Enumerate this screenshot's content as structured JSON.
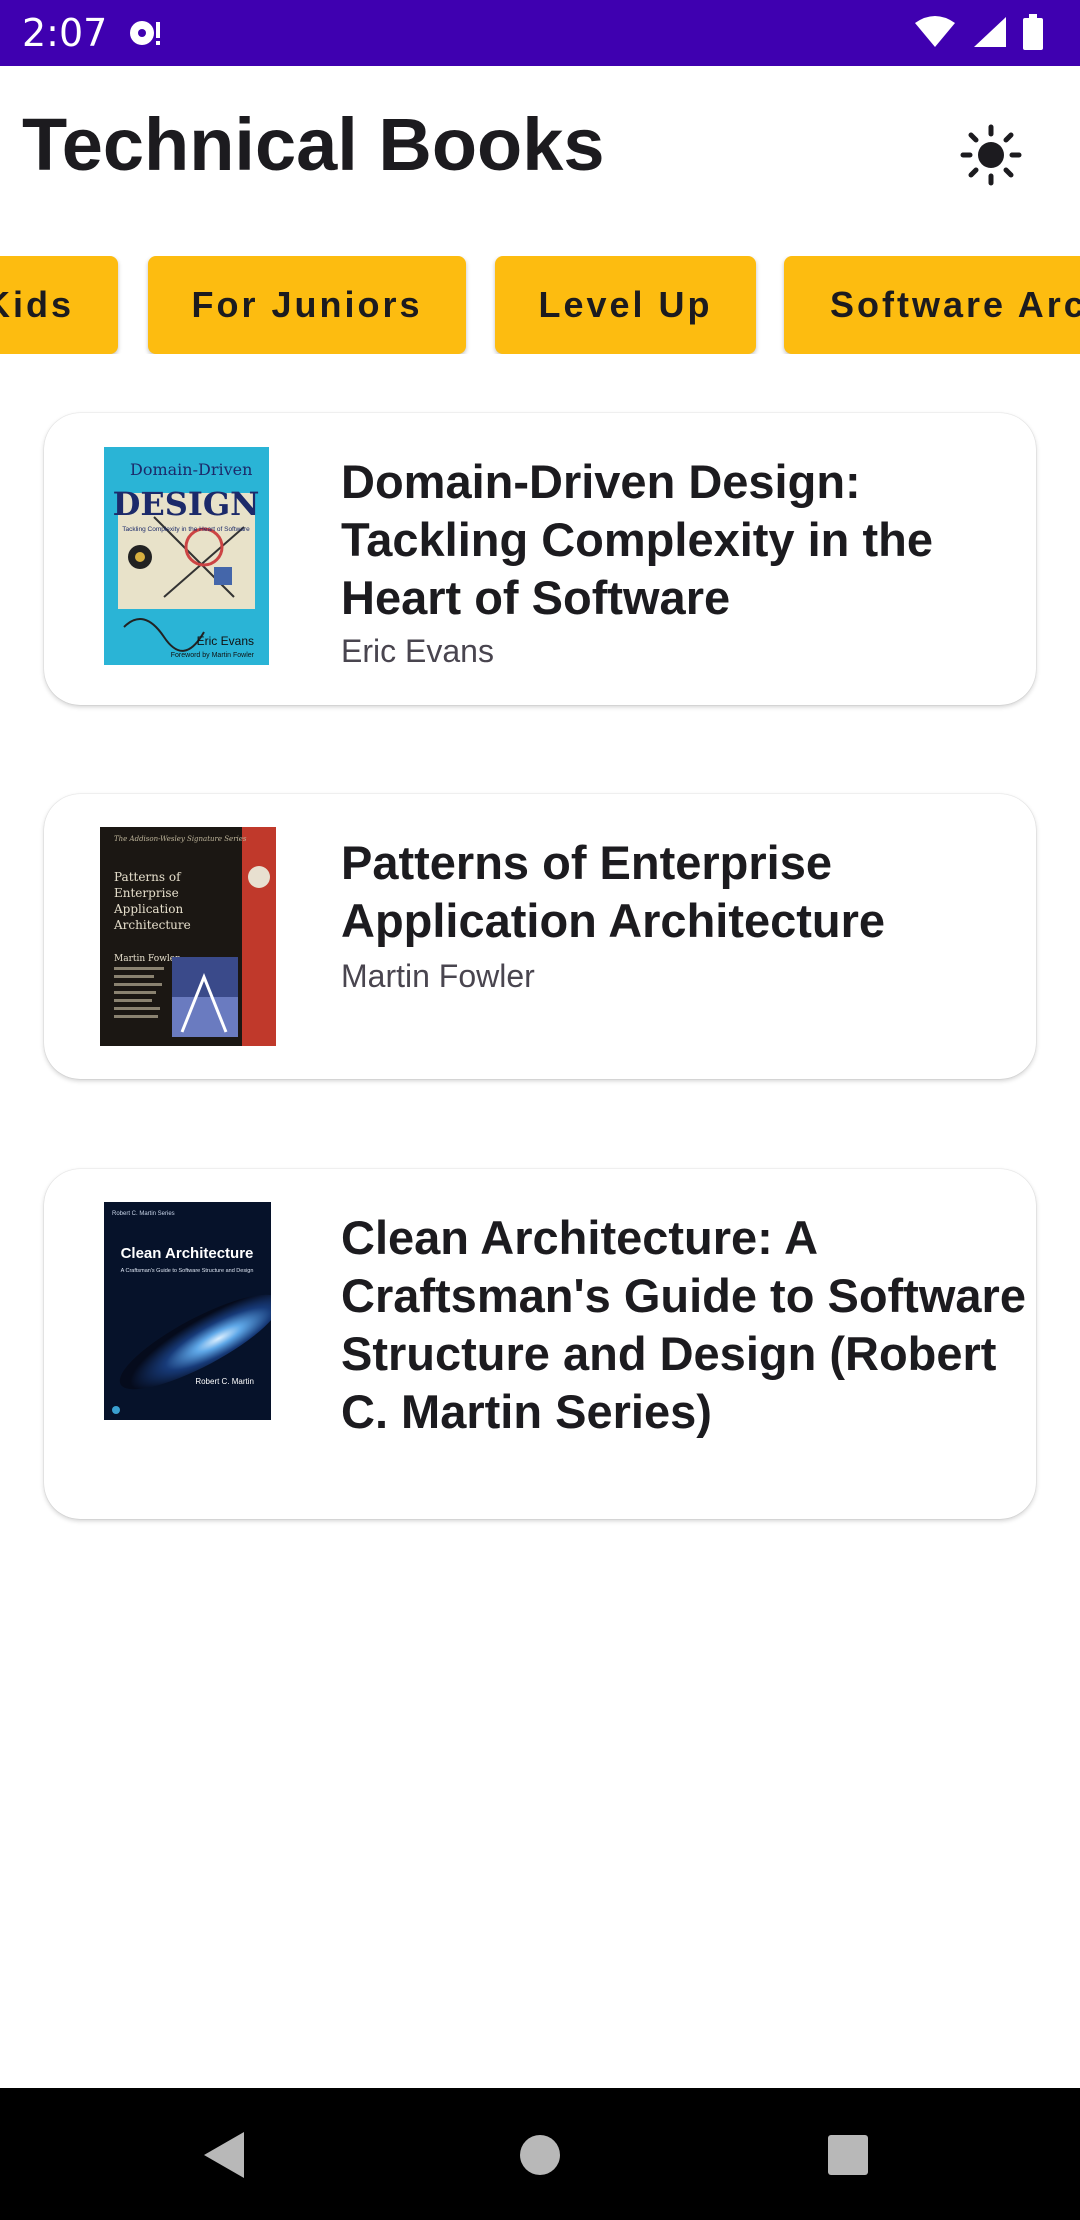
{
  "status_bar": {
    "time": "2:07",
    "background": "#3f00b0",
    "icons": [
      "notification-icon",
      "wifi-icon",
      "signal-icon",
      "battery-icon"
    ]
  },
  "header": {
    "title": "Technical Books",
    "theme_toggle_icon": "sun-icon"
  },
  "chips": [
    {
      "label": "Kids"
    },
    {
      "label": "For Juniors"
    },
    {
      "label": "Level Up"
    },
    {
      "label": "Software Arc"
    }
  ],
  "chip_color": "#fdbc10",
  "books": [
    {
      "title": "Domain-Driven Design: Tackling Complexity in the Heart of Software",
      "author": "Eric Evans",
      "cover": {
        "kicker": "Domain-Driven",
        "title": "DESIGN",
        "subtitle": "Tackling Complexity in the Heart of Software",
        "author": "Eric Evans",
        "foreword": "Foreword by Martin Fowler"
      }
    },
    {
      "title": "Patterns of Enterprise Application Architecture",
      "author": "Martin Fowler",
      "cover": {
        "series": "The Addison-Wesley Signature Series",
        "title_lines": [
          "Patterns of",
          "Enterprise",
          "Application",
          "Architecture"
        ],
        "author": "Martin Fowler"
      }
    },
    {
      "title": "Clean Architecture: A Craftsman's Guide to Software Structure and Design (Robert C. Martin Series)",
      "author": "",
      "cover": {
        "series": "Robert C. Martin Series",
        "title": "Clean Architecture",
        "subtitle": "A Craftsman's Guide to Software Structure and Design",
        "author": "Robert C. Martin"
      }
    }
  ],
  "nav": {
    "back_icon": "back-triangle-icon",
    "home_icon": "home-circle-icon",
    "recents_icon": "recents-square-icon"
  }
}
